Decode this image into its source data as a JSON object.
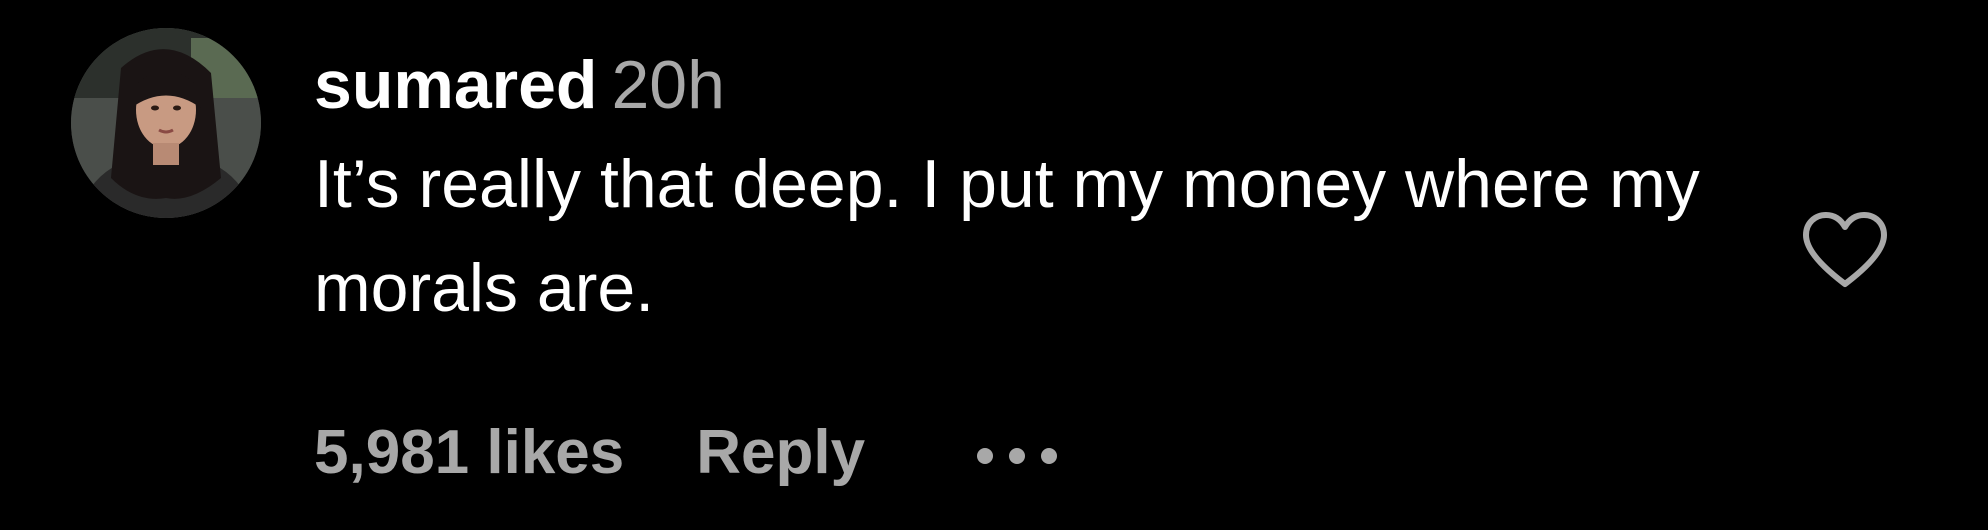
{
  "comment": {
    "username": "sumared",
    "timestamp": "20h",
    "text": "It’s really that deep. I put my money where my morals are.",
    "likes": "5,981 likes",
    "reply_label": "Reply"
  },
  "icons": {
    "like": "heart-outline-icon",
    "more": "more-options-icon"
  },
  "colors": {
    "background": "#000000",
    "primary_text": "#ffffff",
    "secondary_text": "#a8a8a8"
  }
}
